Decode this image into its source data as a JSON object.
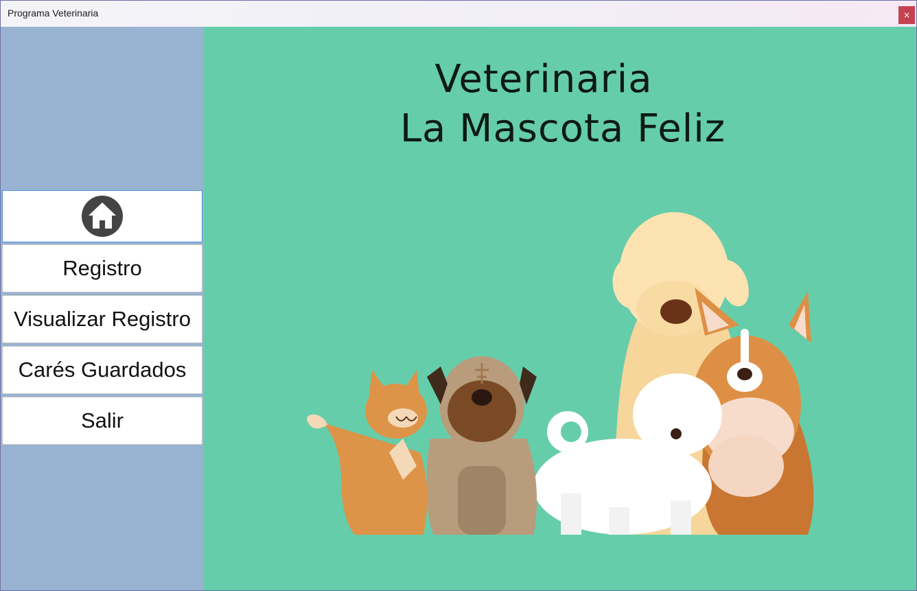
{
  "window": {
    "title": "Programa Veterinaria",
    "close_label": "×"
  },
  "sidebar": {
    "items": [
      {
        "label": "",
        "icon": "home-icon"
      },
      {
        "label": "Registro"
      },
      {
        "label": "Visualizar Registro"
      },
      {
        "label": "Carés Guardados"
      },
      {
        "label": "Salir"
      }
    ]
  },
  "main": {
    "title_line1": "Veterinaria",
    "title_line2": "La Mascota Feliz",
    "illustration": "pets-group-illustration"
  },
  "colors": {
    "sidebar_bg": "#98b3d1",
    "main_bg": "#66cdaa",
    "close_button": "#c4424f"
  }
}
